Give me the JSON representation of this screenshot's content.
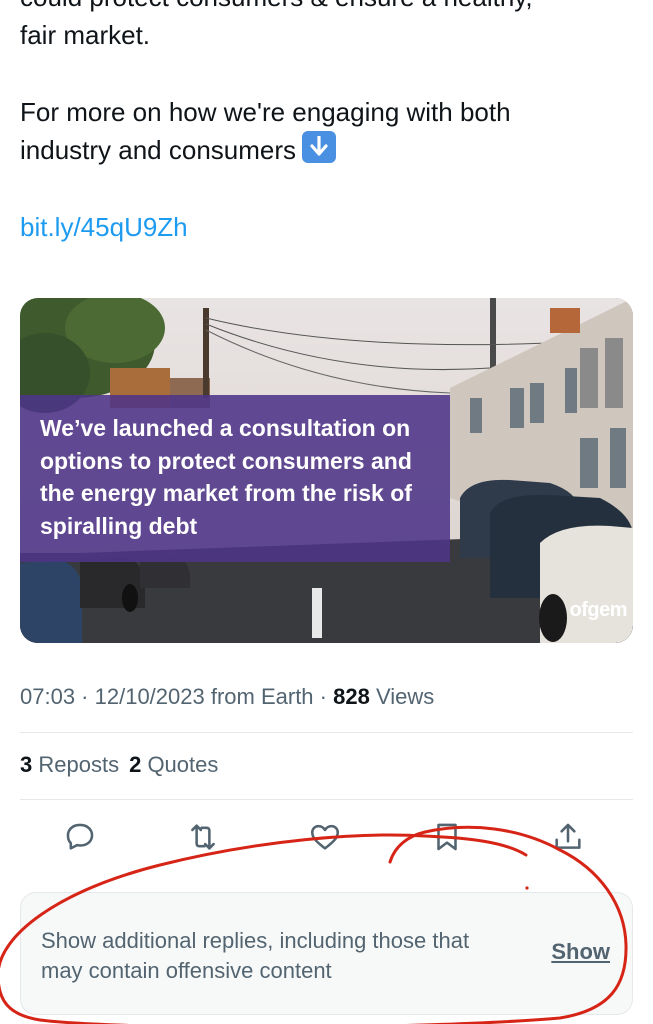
{
  "tweet": {
    "line_top": "could protect consumers & ensure a healthy,",
    "line_top2": "fair market.",
    "para2_line1": "For more on how we're engaging with both",
    "para2_line2": "industry and consumers",
    "emoji": "down-arrow-emoji",
    "link": "bit.ly/45qU9Zh"
  },
  "card": {
    "banner_text": "We’ve launched a consultation on options to protect consumers and the energy market from the risk of spiralling debt",
    "logo": "ofgem",
    "banner_color": "#4d3487"
  },
  "meta": {
    "time": "07:03",
    "sep1": " · ",
    "date": "12/10/2023",
    "source": " from Earth",
    "sep2": " · ",
    "views_count": "828",
    "views_label": " Views"
  },
  "stats": {
    "reposts_count": "3",
    "reposts_label": " Reposts",
    "quotes_count": "2",
    "quotes_label": " Quotes"
  },
  "actions": {
    "icons": [
      "reply-icon",
      "repost-icon",
      "like-icon",
      "bookmark-icon",
      "share-icon"
    ]
  },
  "replies_notice": {
    "text": "Show additional replies, including those that may contain offensive content",
    "button": "Show"
  },
  "annotation": {
    "color": "#d62516"
  }
}
